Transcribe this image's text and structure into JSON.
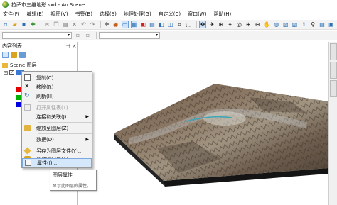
{
  "window": {
    "title": "拉萨市三维地形.sxd - ArcScene"
  },
  "menu": [
    "文件(F)",
    "编辑(E)",
    "视图(V)",
    "书签(B)",
    "选择(S)",
    "地理处理(G)",
    "自定义(C)",
    "窗口(W)",
    "帮助(H)"
  ],
  "toc": {
    "title": "内容列表",
    "scene_label": "Scene 图层",
    "swatch_colors": [
      "#e00000",
      "#00b000",
      "#0000e0"
    ]
  },
  "context_menu": {
    "items": [
      {
        "label": "复制(C)",
        "icon": "copy-icon",
        "disabled": false
      },
      {
        "label": "移除(R)",
        "icon": "remove-icon",
        "disabled": false
      },
      {
        "label": "刷新(H)",
        "icon": "refresh-icon",
        "disabled": false
      },
      {
        "label": "打开属性表(T)",
        "icon": "table-icon",
        "disabled": true
      },
      {
        "label": "连接和关联(J)",
        "icon": "",
        "disabled": false,
        "submenu": true
      },
      {
        "label": "缩放至图层(Z)",
        "icon": "zoom-layer-icon",
        "disabled": false
      },
      {
        "label": "数据(D)",
        "icon": "",
        "disabled": false,
        "submenu": true
      },
      {
        "label": "另存为图层文件(Y)...",
        "icon": "save-layer-icon",
        "disabled": false
      },
      {
        "label": "创建图层包(A)...",
        "icon": "layer-package-icon",
        "disabled": false
      },
      {
        "label": "属性(I)...",
        "icon": "properties-icon",
        "disabled": false,
        "highlighted": true
      }
    ]
  },
  "tooltip": {
    "title": "图层属性",
    "description": "显示此图层的属性。"
  },
  "colors": {
    "accent": "#cfe3fb",
    "highlight_border": "#7ea9dc"
  }
}
